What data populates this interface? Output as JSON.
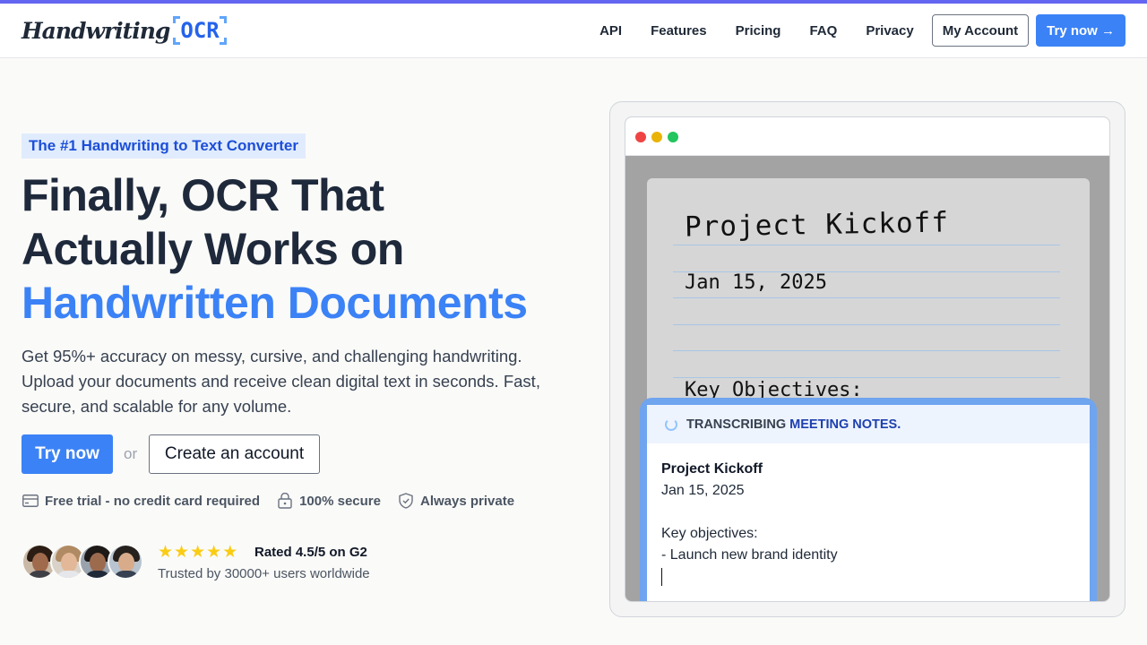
{
  "header": {
    "logo_script": "Handwriting",
    "logo_ocr": "OCR",
    "nav": [
      "API",
      "Features",
      "Pricing",
      "FAQ",
      "Privacy"
    ],
    "account_label": "My Account",
    "try_label": "Try now →"
  },
  "hero": {
    "badge": "The #1 Handwriting to Text Converter",
    "title_line1": "Finally, OCR That",
    "title_line2": "Actually Works on",
    "title_highlight": "Handwritten Documents",
    "description": "Get 95%+ accuracy on messy, cursive, and challenging handwriting. Upload your documents and receive clean digital text in seconds. Fast, secure, and scalable for any volume.",
    "cta_primary": "Try now",
    "cta_or": "or",
    "cta_secondary": "Create an account",
    "features": [
      {
        "icon": "credit-card-icon",
        "label": "Free trial - no credit card required"
      },
      {
        "icon": "lock-icon",
        "label": "100% secure"
      },
      {
        "icon": "shield-check-icon",
        "label": "Always private"
      }
    ],
    "rating": {
      "stars": 5,
      "label": "Rated 4.5/5 on G2"
    },
    "trusted": "Trusted by 30000+ users worldwide"
  },
  "mockup": {
    "handwriting": [
      "Project Kickoff",
      "Jan 15, 2025",
      "Key Objectives:"
    ],
    "status_prefix": "TRANSCRIBING",
    "status_doc": "MEETING NOTES.",
    "transcript": {
      "title": "Project Kickoff",
      "date": "Jan 15, 2025",
      "objectives_label": "Key objectives:",
      "item1": "- Launch new brand identity"
    }
  },
  "colors": {
    "accent": "#3b82f6",
    "accent_dark": "#1d4ed8",
    "top_bar": "#6366f1",
    "star": "#facc15"
  }
}
